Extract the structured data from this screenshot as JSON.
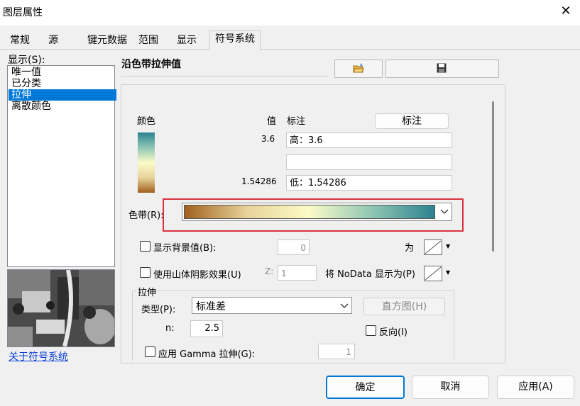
{
  "window": {
    "title": "图层属性",
    "close_glyph": "✕"
  },
  "tabs": [
    "常规",
    "源",
    "键元数据",
    "范围",
    "显示",
    "符号系统"
  ],
  "show_label": "显示(S):",
  "render_types": [
    "唯一值",
    "已分类",
    "拉伸",
    "离散颜色"
  ],
  "selected_render_type": "拉伸",
  "about_link": "关于符号系统",
  "section_title": "沿色带拉伸值",
  "headers": {
    "color": "颜色",
    "value": "值",
    "label": "标注",
    "label_button": "标注"
  },
  "values": {
    "high": "3.6",
    "low": "1.54286"
  },
  "labels": {
    "high": "高：3.6",
    "mid": "",
    "low": "低：1.54286"
  },
  "ramp": {
    "label": "色带(R):",
    "colors": [
      "#a0601e",
      "#e8d39a",
      "#fbfbc7",
      "#8fc6b4",
      "#2c8290"
    ]
  },
  "background": {
    "label": "显示背景值(B):",
    "value": "0",
    "as_label": "为",
    "checked": false
  },
  "hillshade": {
    "label": "使用山体阴影效果(U)",
    "z_label": "Z:",
    "z_value": "1",
    "nodata_label": "将 NoData 显示为(P)",
    "checked": false
  },
  "stretch": {
    "group_label": "拉伸",
    "type_label": "类型(P):",
    "type_value": "标准差",
    "histogram_button": "直方图(H)",
    "n_label": "n:",
    "n_value": "2.5",
    "invert_label": "反向(I)",
    "gamma_label": "应用 Gamma 拉伸(G):",
    "gamma_value": "1"
  },
  "footer": {
    "ok": "确定",
    "cancel": "取消",
    "apply": "应用(A)"
  },
  "icons": {
    "open": "folder-open-icon",
    "save": "floppy-disk-icon",
    "dropdown": "chevron-down-icon"
  },
  "accent": "#0078d7",
  "highlight_box": "#d9333f"
}
